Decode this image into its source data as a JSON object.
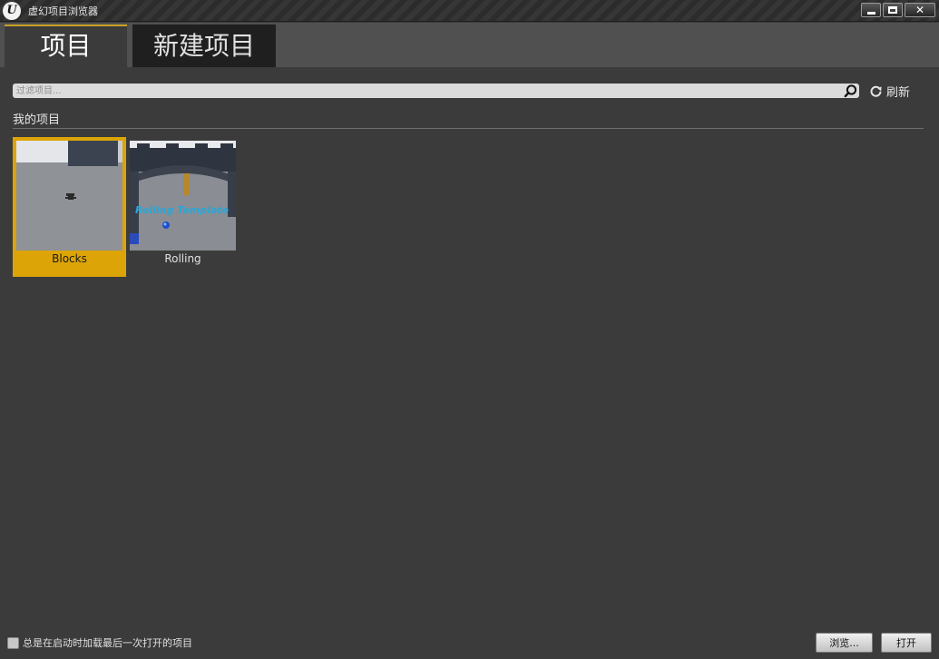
{
  "window": {
    "title": "虚幻项目浏览器",
    "logo_text": "U",
    "controls": [
      "minimize",
      "maximize",
      "close"
    ]
  },
  "tabs": [
    {
      "label": "项目",
      "active": true
    },
    {
      "label": "新建项目",
      "active": false
    }
  ],
  "search": {
    "placeholder": "过滤项目...",
    "value": ""
  },
  "refresh": {
    "label": "刷新"
  },
  "section": {
    "title": "我的项目"
  },
  "projects": [
    {
      "name": "Blocks",
      "selected": true
    },
    {
      "name": "Rolling",
      "selected": false,
      "thumbnail_text": "Rolling Template"
    }
  ],
  "footer": {
    "autoload_label": "总是在启动时加载最后一次打开的项目",
    "autoload_checked": false,
    "browse_label": "浏览...",
    "open_label": "打开"
  },
  "colors": {
    "background": "#3b3b3b",
    "tab_band": "#505050",
    "selection": "#dca407",
    "active_tab_accent": "#c9a227"
  }
}
